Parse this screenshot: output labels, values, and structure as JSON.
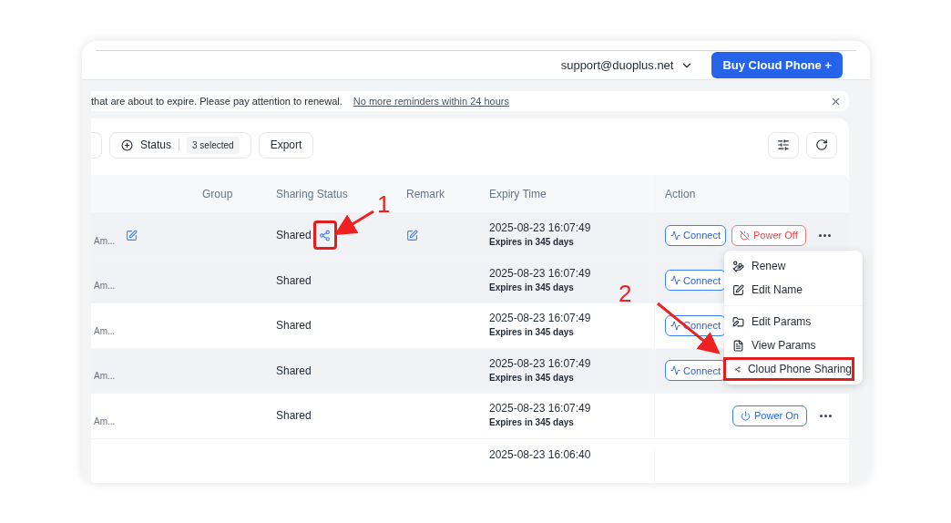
{
  "header": {
    "account": "support@duoplus.net",
    "buy_button": "Buy Cloud Phone +"
  },
  "notice": {
    "text": "that are about to expire. Please pay attention to renewal.",
    "link": "No more reminders within 24 hours"
  },
  "toolbar": {
    "status_filter": {
      "label": "Status",
      "badge": "3 selected"
    },
    "export_button": "Export"
  },
  "table": {
    "columns": [
      "Group",
      "Sharing Status",
      "Remark",
      "Expiry Time",
      "Action"
    ],
    "rows": [
      {
        "shaded": true,
        "name_sub": "Am...",
        "name_edit": true,
        "sharing": "Shared",
        "share_highlighted": true,
        "remark_edit": true,
        "expiry": "2025-08-23 16:07:49",
        "expires_in": "Expires in 345 days",
        "actions": [
          {
            "kind": "connect",
            "label": "Connect"
          },
          {
            "kind": "power_off",
            "label": "Power Off"
          },
          {
            "kind": "more"
          }
        ]
      },
      {
        "shaded": true,
        "name_sub": "Am...",
        "sharing": "Shared",
        "expiry": "2025-08-23 16:07:49",
        "expires_in": "Expires in 345 days",
        "actions": [
          {
            "kind": "connect",
            "label": "Connect"
          }
        ]
      },
      {
        "shaded": false,
        "name_sub": "Am...",
        "sharing": "Shared",
        "expiry": "2025-08-23 16:07:49",
        "expires_in": "Expires in 345 days",
        "actions": [
          {
            "kind": "connect",
            "label": "Connect"
          }
        ]
      },
      {
        "shaded": true,
        "name_sub": "Am...",
        "sharing": "Shared",
        "expiry": "2025-08-23 16:07:49",
        "expires_in": "Expires in 345 days",
        "actions": [
          {
            "kind": "connect",
            "label": "Connect"
          }
        ]
      },
      {
        "shaded": false,
        "name_sub": "Am...",
        "sharing": "Shared",
        "expiry": "2025-08-23 16:07:49",
        "expires_in": "Expires in 345 days",
        "actions": [
          {
            "kind": "power_on",
            "label": "Power On"
          },
          {
            "kind": "more"
          }
        ]
      },
      {
        "expiry": "2025-08-23 16:06:40",
        "actions": []
      }
    ]
  },
  "menu": {
    "items": [
      {
        "kind": "renew",
        "label": "Renew",
        "divider_before": false,
        "highlighted": false
      },
      {
        "kind": "edit_name",
        "label": "Edit Name",
        "divider_before": false,
        "highlighted": false
      },
      {
        "kind": "edit_params",
        "label": "Edit Params",
        "divider_before": true,
        "highlighted": false
      },
      {
        "kind": "view_params",
        "label": "View Params",
        "divider_before": false,
        "highlighted": false
      },
      {
        "kind": "sharing",
        "label": "Cloud Phone Sharing",
        "divider_before": false,
        "highlighted": true
      }
    ]
  },
  "annotations": [
    {
      "label": "1"
    },
    {
      "label": "2"
    }
  ]
}
